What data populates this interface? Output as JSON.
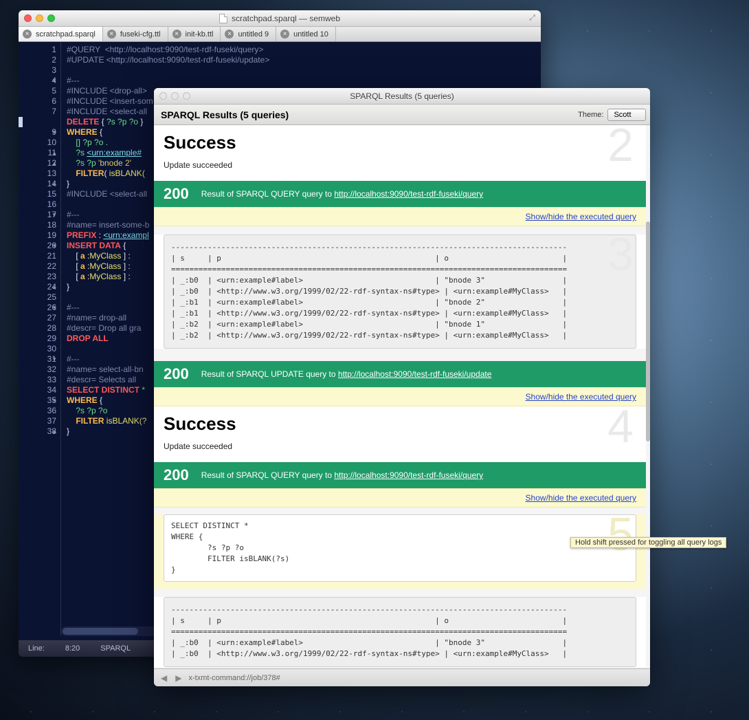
{
  "editor_window": {
    "title": "scratchpad.sparql — semweb",
    "tabs": [
      {
        "label": "scratchpad.sparql",
        "active": true
      },
      {
        "label": "fuseki-cfg.ttl",
        "active": false
      },
      {
        "label": "init-kb.ttl",
        "active": false
      },
      {
        "label": "untitled 9",
        "active": false
      },
      {
        "label": "untitled 10",
        "active": false
      }
    ],
    "gutter": [
      {
        "n": "1"
      },
      {
        "n": "2"
      },
      {
        "n": "3"
      },
      {
        "n": "4",
        "mark": "▼"
      },
      {
        "n": "5"
      },
      {
        "n": "6"
      },
      {
        "n": "7"
      },
      {
        "n": "8",
        "hl": true
      },
      {
        "n": "9",
        "mark": "▼"
      },
      {
        "n": "10"
      },
      {
        "n": "11",
        "mark": "▲"
      },
      {
        "n": "12",
        "mark": "▲"
      },
      {
        "n": "13"
      },
      {
        "n": "14",
        "mark": "▲"
      },
      {
        "n": "15"
      },
      {
        "n": "16"
      },
      {
        "n": "17",
        "mark": "▼"
      },
      {
        "n": "18"
      },
      {
        "n": "19"
      },
      {
        "n": "20",
        "mark": "▼"
      },
      {
        "n": "21"
      },
      {
        "n": "22"
      },
      {
        "n": "23"
      },
      {
        "n": "24",
        "mark": "▲"
      },
      {
        "n": "25"
      },
      {
        "n": "26",
        "mark": "▼"
      },
      {
        "n": "27"
      },
      {
        "n": "28"
      },
      {
        "n": "29"
      },
      {
        "n": "30"
      },
      {
        "n": "31",
        "mark": "▼"
      },
      {
        "n": "32"
      },
      {
        "n": "33"
      },
      {
        "n": "34"
      },
      {
        "n": "35",
        "mark": "▼"
      },
      {
        "n": "36"
      },
      {
        "n": "37"
      },
      {
        "n": "38",
        "mark": "▲"
      }
    ],
    "lines": {
      "l1": "#QUERY  <http://localhost:9090/test-rdf-fuseki/query>",
      "l2": "#UPDATE <http://localhost:9090/test-rdf-fuseki/update>",
      "l4": "#---",
      "l5": "#INCLUDE <drop-all>",
      "l6": "#INCLUDE <insert-som",
      "l7": "#INCLUDE <select-all",
      "l8a": "DELETE",
      "l8b": " { ",
      "l8c": "?s ?p ?o",
      "l8d": " }",
      "l9a": "WHERE",
      "l9b": " {",
      "l10": "    [] ?p ?o .",
      "l11a": "    ?s ",
      "l11b": "<urn:example#",
      "l12a": "    ?s ?p ",
      "l12b": "'bnode 2'",
      "l13a": "    FILTER",
      "l13b": "( ",
      "l13c": "isBLANK(",
      "l14": "}",
      "l15": "#INCLUDE <select-all",
      "l17": "#---",
      "l18": "#name= insert-some-b",
      "l19a": "PREFIX",
      "l19b": " : ",
      "l19c": "<urn:exampl",
      "l20a": "INSERT DATA",
      "l20b": " {",
      "l21a": "    [ ",
      "l21b": "a",
      "l21c": " :",
      "l21d": "MyClass",
      "l21e": " ] :",
      "l22a": "    [ ",
      "l22b": "a",
      "l22c": " :",
      "l22d": "MyClass",
      "l22e": " ] :",
      "l23a": "    [ ",
      "l23b": "a",
      "l23c": " :",
      "l23d": "MyClass",
      "l23e": " ] :",
      "l24": "}",
      "l26": "#---",
      "l27": "#name= drop-all",
      "l28": "#descr= Drop all gra",
      "l29": "DROP ALL",
      "l31": "#---",
      "l32": "#name= select-all-bn",
      "l33": "#descr= Selects all ",
      "l34a": "SELECT DISTINCT",
      "l34b": " *",
      "l35a": "WHERE",
      "l35b": " {",
      "l36": "    ?s ?p ?o",
      "l37a": "    FILTER",
      "l37b": " isBLANK(?",
      "l38": "}"
    },
    "status": {
      "line_label": "Line:",
      "pos": "8:20",
      "lang": "SPARQL"
    }
  },
  "results_window": {
    "titlebar": "SPARQL Results (5 queries)",
    "header": "SPARQL Results (5 queries)",
    "theme_label": "Theme:",
    "theme_value": "Scott",
    "blocks": {
      "b2": {
        "num": "2",
        "heading": "Success",
        "msg": "Update succeeded"
      },
      "g3": {
        "code": "200",
        "text": "Result of SPARQL QUERY query to ",
        "url": "http://localhost:9090/test-rdf-fuseki/query"
      },
      "toggle": "Show/hide the executed query",
      "table3": "---------------------------------------------------------------------------------------\n| s     | p                                               | o                         |\n=======================================================================================\n| _:b0  | <urn:example#label>                             | \"bnode 3\"                 |\n| _:b0  | <http://www.w3.org/1999/02/22-rdf-syntax-ns#type> | <urn:example#MyClass>   |\n| _:b1  | <urn:example#label>                             | \"bnode 2\"                 |\n| _:b1  | <http://www.w3.org/1999/02/22-rdf-syntax-ns#type> | <urn:example#MyClass>   |\n| _:b2  | <urn:example#label>                             | \"bnode 1\"                 |\n| _:b2  | <http://www.w3.org/1999/02/22-rdf-syntax-ns#type> | <urn:example#MyClass>   |",
      "g4": {
        "code": "200",
        "text": "Result of SPARQL UPDATE query to ",
        "url": "http://localhost:9090/test-rdf-fuseki/update"
      },
      "b4": {
        "num": "4",
        "heading": "Success",
        "msg": "Update succeeded"
      },
      "g5": {
        "code": "200",
        "text": "Result of SPARQL QUERY query to ",
        "url": "http://localhost:9090/test-rdf-fuseki/query"
      },
      "b5num": "5",
      "query5": "SELECT DISTINCT *\nWHERE {\n        ?s ?p ?o\n        FILTER isBLANK(?s)\n}",
      "table5": "---------------------------------------------------------------------------------------\n| s     | p                                               | o                         |\n=======================================================================================\n| _:b0  | <urn:example#label>                             | \"bnode 3\"                 |\n| _:b0  | <http://www.w3.org/1999/02/22-rdf-syntax-ns#type> | <urn:example#MyClass>   |"
    },
    "footer": {
      "back": "◀",
      "fwd": "▶",
      "url": "x-txmt-command://job/378#"
    }
  },
  "tooltip": "Hold shift pressed for toggling all query logs"
}
